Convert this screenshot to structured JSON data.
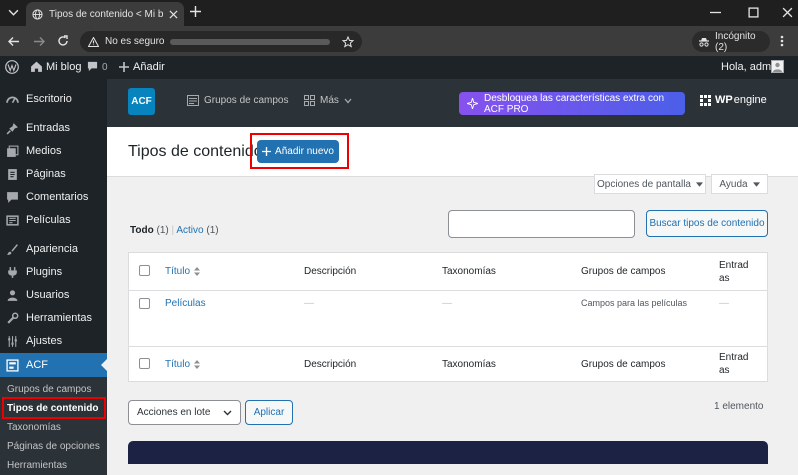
{
  "browser": {
    "tab_title": "Tipos de contenido < Mi blog -",
    "security_label": "No es seguro",
    "incognito_label": "Incógnito (2)"
  },
  "adminbar": {
    "site_name": "Mi blog",
    "comments_count": "0",
    "new_label": "Añadir",
    "greeting": "Hola, admin"
  },
  "menu": {
    "items": [
      {
        "label": "Escritorio",
        "icon": "dashboard-icon"
      },
      {
        "label": "Entradas",
        "icon": "pin-icon"
      },
      {
        "label": "Medios",
        "icon": "media-icon"
      },
      {
        "label": "Páginas",
        "icon": "pages-icon"
      },
      {
        "label": "Comentarios",
        "icon": "comments-icon"
      },
      {
        "label": "Películas",
        "icon": "post-type-icon"
      },
      {
        "label": "Apariencia",
        "icon": "brush-icon"
      },
      {
        "label": "Plugins",
        "icon": "plugin-icon"
      },
      {
        "label": "Usuarios",
        "icon": "users-icon"
      },
      {
        "label": "Herramientas",
        "icon": "tools-icon"
      },
      {
        "label": "Ajustes",
        "icon": "settings-icon"
      },
      {
        "label": "ACF",
        "icon": "acf-icon"
      }
    ],
    "subitems": [
      {
        "label": "Grupos de campos"
      },
      {
        "label": "Tipos de contenido"
      },
      {
        "label": "Taxonomías"
      },
      {
        "label": "Páginas de opciones"
      },
      {
        "label": "Herramientas"
      }
    ]
  },
  "acf": {
    "logo": "ACF",
    "nav_field_groups": "Grupos de campos",
    "nav_more": "Más",
    "promo": "Desbloquea las características extra con ACF PRO",
    "partner_bold": "WP",
    "partner_rest": "engine"
  },
  "page": {
    "title": "Tipos de contenido",
    "add_new": "Añadir nuevo",
    "screen_options": "Opciones de pantalla",
    "help": "Ayuda",
    "views": {
      "all_label": "Todo",
      "all_count": "(1)",
      "active_label": "Activo",
      "active_count": "(1)",
      "separator": "|"
    },
    "search_button": "Buscar tipos de contenido"
  },
  "table": {
    "columns": [
      "Título",
      "Descripción",
      "Taxonomías",
      "Grupos de campos",
      "Entrad",
      "as"
    ],
    "rows": [
      {
        "title": "Películas",
        "description": "—",
        "taxonomies": "—",
        "field_groups": "Campos para las películas",
        "posts": "—"
      }
    ]
  },
  "bulk": {
    "actions_label": "Acciones en lote",
    "apply_label": "Aplicar",
    "count": "1 elemento"
  },
  "colors": {
    "wp_blue": "#2271b1",
    "admin_dark": "#1d2327",
    "highlight_red": "#e00000",
    "acf_blue": "#0783be"
  }
}
